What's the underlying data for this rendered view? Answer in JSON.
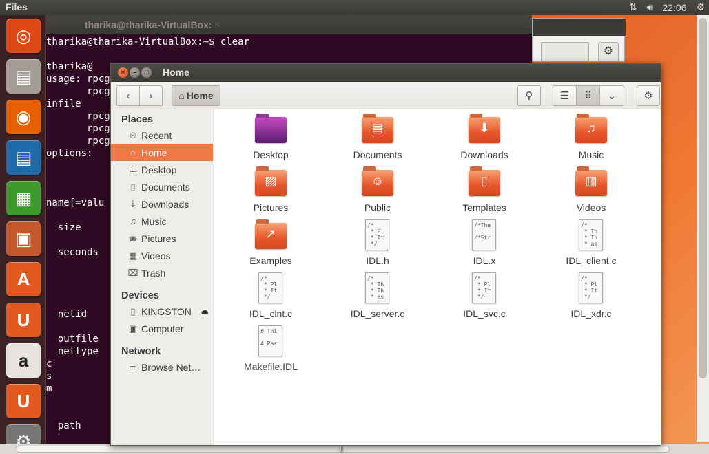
{
  "top_panel": {
    "app_name": "Files",
    "network_icon": "network-arrows-icon",
    "volume_icon": "speaker-icon",
    "clock": "22:06"
  },
  "launcher": {
    "items": [
      {
        "name": "ubuntu-dash",
        "glyph": "◎",
        "color": "#dd4814"
      },
      {
        "name": "files",
        "glyph": "▤",
        "color": "#a39d95"
      },
      {
        "name": "firefox",
        "glyph": "◉",
        "color": "#e66000"
      },
      {
        "name": "libreoffice-writer",
        "glyph": "▤",
        "color": "#1f6aa8"
      },
      {
        "name": "libreoffice-calc",
        "glyph": "▦",
        "color": "#3e9a2d"
      },
      {
        "name": "libreoffice-impress",
        "glyph": "▣",
        "color": "#c5582b"
      },
      {
        "name": "ubuntu-software-center",
        "glyph": "A",
        "color": "#e2591f"
      },
      {
        "name": "ubuntu-one",
        "glyph": "U",
        "color": "#e2591f"
      },
      {
        "name": "amazon",
        "glyph": "a",
        "color": "#e7e3df"
      },
      {
        "name": "ubuntu-one-music",
        "glyph": "U",
        "color": "#e2591f"
      },
      {
        "name": "system-settings",
        "glyph": "⚙",
        "color": "#777"
      }
    ]
  },
  "terminal": {
    "title": "tharika@tharika-VirtualBox: ~",
    "lines": [
      "tharika@tharika-VirtualBox:~$ clear",
      "",
      "tharika@",
      "usage: rpcgen",
      "       rpcge",
      "infile",
      "       rpcg",
      "       rpcg",
      "       rpcg",
      "options:",
      "",
      "",
      "",
      "name[=valu",
      "",
      "  size",
      "",
      "  seconds",
      "",
      "",
      "",
      "",
      "  netid",
      "",
      "  outfile",
      "  nettype",
      "c",
      "s",
      "m",
      "",
      "",
      "  path"
    ]
  },
  "window": {
    "title": "Home",
    "toolbar": {
      "back_icon": "‹",
      "forward_icon": "›",
      "breadcrumb": "Home",
      "search_icon": "⚲",
      "list_icon": "☰",
      "grid_icon": "⠿",
      "dropdown_icon": "⌄",
      "gear_icon": "⚙"
    },
    "sidebar": {
      "sections": [
        {
          "heading": "Places",
          "items": [
            {
              "label": "Recent",
              "icon": "⏲"
            },
            {
              "label": "Home",
              "icon": "⌂",
              "active": true
            },
            {
              "label": "Desktop",
              "icon": "▭"
            },
            {
              "label": "Documents",
              "icon": "▯"
            },
            {
              "label": "Downloads",
              "icon": "⇣"
            },
            {
              "label": "Music",
              "icon": "♫"
            },
            {
              "label": "Pictures",
              "icon": "◙"
            },
            {
              "label": "Videos",
              "icon": "▦"
            },
            {
              "label": "Trash",
              "icon": "⌧"
            }
          ]
        },
        {
          "heading": "Devices",
          "items": [
            {
              "label": "KINGSTON",
              "icon": "▯",
              "eject": "⏏"
            },
            {
              "label": "Computer",
              "icon": "▣"
            }
          ]
        },
        {
          "heading": "Network",
          "items": [
            {
              "label": "Browse Net…",
              "icon": "▭"
            }
          ]
        }
      ]
    },
    "files": [
      {
        "label": "Desktop",
        "kind": "folder-desktop",
        "emblem": ""
      },
      {
        "label": "Documents",
        "kind": "folder",
        "emblem": "▤"
      },
      {
        "label": "Downloads",
        "kind": "folder",
        "emblem": "⬇"
      },
      {
        "label": "Music",
        "kind": "folder",
        "emblem": "♫"
      },
      {
        "label": "Pictures",
        "kind": "folder",
        "emblem": "▨"
      },
      {
        "label": "Public",
        "kind": "folder",
        "emblem": "☺"
      },
      {
        "label": "Templates",
        "kind": "folder",
        "emblem": "▯"
      },
      {
        "label": "Videos",
        "kind": "folder",
        "emblem": "▥"
      },
      {
        "label": "Examples",
        "kind": "folder",
        "emblem": "↗"
      },
      {
        "label": "IDL.h",
        "kind": "text",
        "preview": "/*\n * Pl\n * It\n */"
      },
      {
        "label": "IDL.x",
        "kind": "text",
        "preview": "/*The\n\n/*Str"
      },
      {
        "label": "IDL_client.c",
        "kind": "text",
        "preview": "/*\n * Th\n * Th\n * as"
      },
      {
        "label": "IDL_clnt.c",
        "kind": "text",
        "preview": "/*\n * Pl\n * It\n */"
      },
      {
        "label": "IDL_server.c",
        "kind": "text",
        "preview": "/*\n * Th\n * Th\n * as"
      },
      {
        "label": "IDL_svc.c",
        "kind": "text",
        "preview": "/*\n * Pl\n * It\n */"
      },
      {
        "label": "IDL_xdr.c",
        "kind": "text",
        "preview": "/*\n * Pl\n * It\n */"
      },
      {
        "label": "Makefile.IDL",
        "kind": "text",
        "preview": "# Thi\n\n# Par"
      }
    ]
  }
}
